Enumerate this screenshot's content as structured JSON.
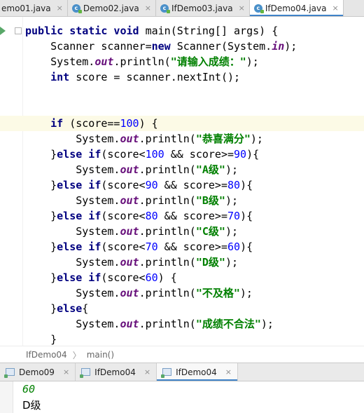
{
  "editor_tabs": [
    {
      "label": "emo01.java",
      "active": false,
      "has_icon": false
    },
    {
      "label": "Demo02.java",
      "active": false,
      "has_icon": true
    },
    {
      "label": "IfDemo03.java",
      "active": false,
      "has_icon": true
    },
    {
      "label": "IfDemo04.java",
      "active": true,
      "has_icon": true
    }
  ],
  "tab_close_glyph": "×",
  "code_lines": [
    [
      [
        "kw",
        "public static void "
      ],
      [
        "t",
        "main(String[] args) {"
      ]
    ],
    [
      [
        "t",
        "    Scanner scanner="
      ],
      [
        "kw",
        "new "
      ],
      [
        "t",
        "Scanner(System."
      ],
      [
        "fld",
        "in"
      ],
      [
        "t",
        ");"
      ]
    ],
    [
      [
        "t",
        "    System."
      ],
      [
        "fld",
        "out"
      ],
      [
        "t",
        ".println("
      ],
      [
        "str",
        "\"请输入成绩：\""
      ],
      [
        "t",
        ");"
      ]
    ],
    [
      [
        "kw",
        "    int "
      ],
      [
        "t",
        "score = scanner.nextInt();"
      ]
    ],
    [
      [
        "t",
        ""
      ]
    ],
    [
      [
        "t",
        ""
      ]
    ],
    [
      [
        "kw",
        "    if "
      ],
      [
        "t",
        "(score=="
      ],
      [
        "num",
        "100"
      ],
      [
        "t",
        ") {"
      ]
    ],
    [
      [
        "t",
        "        System."
      ],
      [
        "fld",
        "out"
      ],
      [
        "t",
        ".println("
      ],
      [
        "str",
        "\"恭喜满分\""
      ],
      [
        "t",
        ");"
      ]
    ],
    [
      [
        "t",
        "    }"
      ],
      [
        "kw",
        "else if"
      ],
      [
        "t",
        "(score<"
      ],
      [
        "num",
        "100"
      ],
      [
        "t",
        " && score>="
      ],
      [
        "num",
        "90"
      ],
      [
        "t",
        "){"
      ]
    ],
    [
      [
        "t",
        "        System."
      ],
      [
        "fld",
        "out"
      ],
      [
        "t",
        ".println("
      ],
      [
        "str",
        "\"A级\""
      ],
      [
        "t",
        ");"
      ]
    ],
    [
      [
        "t",
        "    }"
      ],
      [
        "kw",
        "else if"
      ],
      [
        "t",
        "(score<"
      ],
      [
        "num",
        "90"
      ],
      [
        "t",
        " && score>="
      ],
      [
        "num",
        "80"
      ],
      [
        "t",
        "){"
      ]
    ],
    [
      [
        "t",
        "        System."
      ],
      [
        "fld",
        "out"
      ],
      [
        "t",
        ".println("
      ],
      [
        "str",
        "\"B级\""
      ],
      [
        "t",
        ");"
      ]
    ],
    [
      [
        "t",
        "    }"
      ],
      [
        "kw",
        "else if"
      ],
      [
        "t",
        "(score<"
      ],
      [
        "num",
        "80"
      ],
      [
        "t",
        " && score>="
      ],
      [
        "num",
        "70"
      ],
      [
        "t",
        "){"
      ]
    ],
    [
      [
        "t",
        "        System."
      ],
      [
        "fld",
        "out"
      ],
      [
        "t",
        ".println("
      ],
      [
        "str",
        "\"C级\""
      ],
      [
        "t",
        ");"
      ]
    ],
    [
      [
        "t",
        "    }"
      ],
      [
        "kw",
        "else if"
      ],
      [
        "t",
        "(score<"
      ],
      [
        "num",
        "70"
      ],
      [
        "t",
        " && score>="
      ],
      [
        "num",
        "60"
      ],
      [
        "t",
        "){"
      ]
    ],
    [
      [
        "t",
        "        System."
      ],
      [
        "fld",
        "out"
      ],
      [
        "t",
        ".println("
      ],
      [
        "str",
        "\"D级\""
      ],
      [
        "t",
        ");"
      ]
    ],
    [
      [
        "t",
        "    }"
      ],
      [
        "kw",
        "else if"
      ],
      [
        "t",
        "(score<"
      ],
      [
        "num",
        "60"
      ],
      [
        "t",
        ") {"
      ]
    ],
    [
      [
        "t",
        "        System."
      ],
      [
        "fld",
        "out"
      ],
      [
        "t",
        ".println("
      ],
      [
        "str",
        "\"不及格\""
      ],
      [
        "t",
        ");"
      ]
    ],
    [
      [
        "t",
        "    }"
      ],
      [
        "kw",
        "else"
      ],
      [
        "t",
        "{"
      ]
    ],
    [
      [
        "t",
        "        System."
      ],
      [
        "fld",
        "out"
      ],
      [
        "t",
        ".println("
      ],
      [
        "str",
        "\"成绩不合法\""
      ],
      [
        "t",
        ");"
      ]
    ],
    [
      [
        "t",
        "    }"
      ]
    ]
  ],
  "highlighted_line": 6,
  "breadcrumb": {
    "class_name": "IfDemo04",
    "separator": "〉",
    "method_name": "main()"
  },
  "run_tabs": [
    {
      "label": "Demo09",
      "active": false
    },
    {
      "label": "IfDemo04",
      "active": false
    },
    {
      "label": "IfDemo04",
      "active": true
    }
  ],
  "console": {
    "input_echo": "60",
    "output": "D级"
  },
  "colors": {
    "keyword": "#000080",
    "field": "#660e7a",
    "string": "#008000",
    "number": "#0000ff",
    "tab_accent": "#4083c9"
  }
}
